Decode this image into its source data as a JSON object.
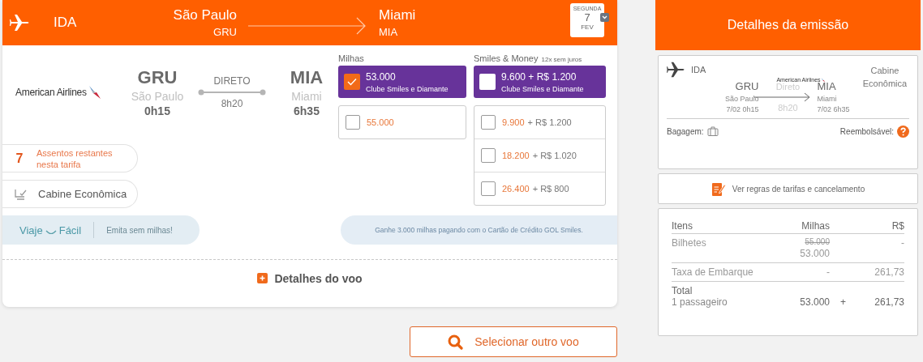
{
  "header": {
    "direction": "IDA",
    "origin_city": "São Paulo",
    "origin_code": "GRU",
    "dest_city": "Miami",
    "dest_code": "MIA",
    "date": {
      "weekday": "SEGUNDA",
      "day": "7",
      "month": "FEV"
    }
  },
  "flight": {
    "airline": "American Airlines",
    "origin_code": "GRU",
    "origin_city": "São Paulo",
    "origin_time": "0h15",
    "stop": "DIRETO",
    "duration": "8h20",
    "dest_code": "MIA",
    "dest_city": "Miami",
    "dest_time": "6h35"
  },
  "seats": {
    "count": "7",
    "label": "Assentos restantes nesta tarifa"
  },
  "cabin": "Cabine Econômica",
  "promo": {
    "brand_left": "Viaje",
    "brand_right": "Fácil",
    "text": "Emita sem milhas!"
  },
  "milhas": {
    "label": "Milhas",
    "featured": {
      "miles": "53.000",
      "subtitle": "Clube Smiles e Diamante",
      "checked": true
    },
    "options": [
      {
        "miles": "55.000",
        "checked": false
      }
    ]
  },
  "smiles_money": {
    "label": "Smiles & Money",
    "note": "12x sem juros",
    "featured": {
      "miles": "9.600",
      "money": "+ R$ 1.200",
      "subtitle": "Clube Smiles e Diamante",
      "checked": false
    },
    "options": [
      {
        "miles": "9.900",
        "money": "+ R$ 1.200",
        "checked": false
      },
      {
        "miles": "18.200",
        "money": "+ R$ 1.020",
        "checked": false
      },
      {
        "miles": "26.400",
        "money": "+ R$ 800",
        "checked": false
      }
    ]
  },
  "banner": "Ganhe 3.000 milhas pagando com o Cartão de Crédito GOL Smiles.",
  "details_link": "Detalhes do voo",
  "select_button": "Selecionar outro voo",
  "summary": {
    "title": "Detalhes da emissão",
    "segment": {
      "direction": "IDA",
      "airline": "American Airlines",
      "cabin": "Cabine Econômica",
      "origin_code": "GRU",
      "origin_city": "São Paulo",
      "origin_datetime": "7/02 0h15",
      "stop": "Direto",
      "duration": "8h20",
      "dest_code": "MIA",
      "dest_city": "Miami",
      "dest_datetime": "7/02 6h35",
      "baggage_label": "Bagagem:",
      "refundable_label": "Reembolsável:"
    },
    "rules_link": "Ver regras de tarifas e cancelamento",
    "columns": [
      "Itens",
      "Milhas",
      "R$"
    ],
    "rows": [
      {
        "item": "Bilhetes",
        "miles_old": "55.000",
        "miles": "53.000",
        "money": "-"
      },
      {
        "item": "Taxa de Embarque",
        "miles": "-",
        "money": "261,73"
      }
    ],
    "total": {
      "label": "Total",
      "passengers": "1 passageiro",
      "miles": "53.000",
      "plus": "+",
      "money": "261,73"
    }
  }
}
